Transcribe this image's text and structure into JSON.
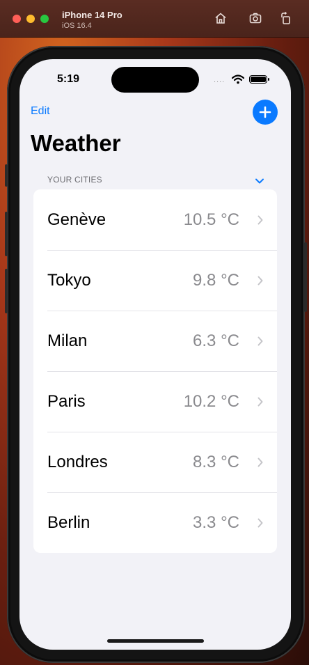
{
  "window": {
    "device_name": "iPhone 14 Pro",
    "os_version": "iOS 16.4",
    "buttons": [
      "home-icon",
      "screenshot-icon",
      "rotate-icon"
    ]
  },
  "status_bar": {
    "time": "5:19",
    "signal_dots": "....",
    "icons": [
      "wifi-icon",
      "battery-icon"
    ]
  },
  "nav": {
    "edit_label": "Edit",
    "add_icon": "plus-icon",
    "title": "Weather"
  },
  "section": {
    "header": "YOUR CITIES",
    "collapse_icon": "chevron-down-icon"
  },
  "cities": [
    {
      "name": "Genève",
      "temp": "10.5 °C"
    },
    {
      "name": "Tokyo",
      "temp": "9.8 °C"
    },
    {
      "name": "Milan",
      "temp": "6.3 °C"
    },
    {
      "name": "Paris",
      "temp": "10.2 °C"
    },
    {
      "name": "Londres",
      "temp": "8.3 °C"
    },
    {
      "name": "Berlin",
      "temp": "3.3 °C"
    }
  ],
  "colors": {
    "accent": "#0a7aff",
    "background": "#f2f2f7",
    "secondary_text": "#8a8a8e"
  }
}
